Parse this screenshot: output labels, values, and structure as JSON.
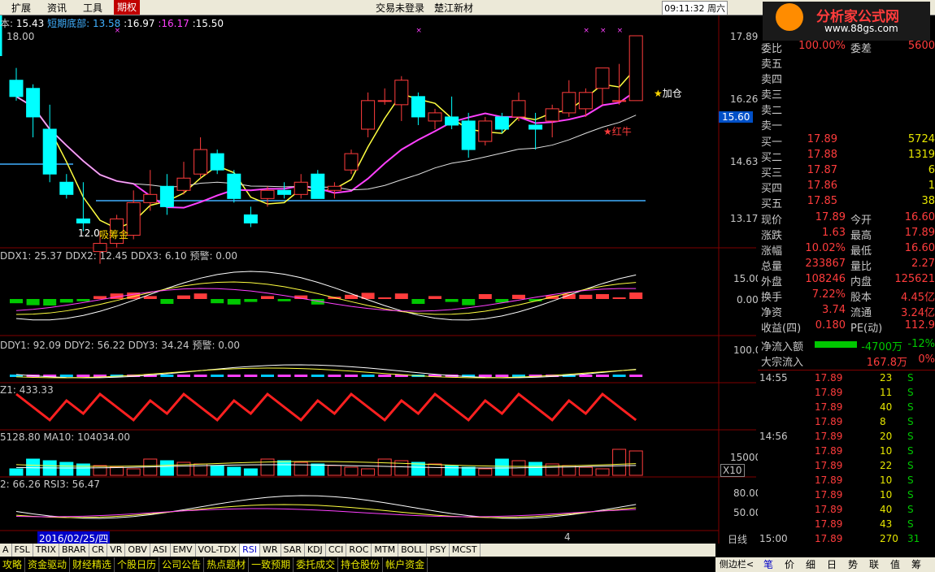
{
  "menu": {
    "items": [
      "扩展",
      "资讯",
      "工具"
    ],
    "active": "期权",
    "status": "交易未登录",
    "stock": "楚江新材",
    "clock": "09:11:32 周六"
  },
  "main": {
    "info": {
      "label": "本:",
      "p1": "15.43",
      "l2": "短期底部:",
      "p2": "13.58",
      "p3": "16.97",
      "p4": "16.17",
      "p5": "15.50"
    },
    "price_scale": [
      "17.89",
      "16.26",
      "14.63",
      "13.17"
    ],
    "left_price": "18.00",
    "current_price": "15.60",
    "annotation_add": "加仓",
    "annotation_red": "红牛",
    "low_label": "12.0",
    "buy_label": "吸筹金"
  },
  "ddx": {
    "info": "DDX1: 25.37  DDX2: 12.45  DDX3: 6.10  预警: 0.00",
    "scale": [
      "15.00",
      "0.00"
    ]
  },
  "ddy": {
    "info": "DDY1: 92.09  DDY2: 56.22  DDY3: 34.24  预警: 0.00",
    "scale": [
      "100.0"
    ]
  },
  "z": {
    "info": "Z1: 433.33"
  },
  "vol": {
    "info": "5128.80   MA10: 104034.00",
    "scale": [
      "15000"
    ],
    "unit": "X10"
  },
  "rsi": {
    "info": "2: 66.26  RSI3: 56.47",
    "scale": [
      "80.00",
      "50.00"
    ]
  },
  "date": "2016/02/25/四",
  "date_tick": "4",
  "period": "日线",
  "tabs": [
    "A",
    "FSL",
    "TRIX",
    "BRAR",
    "CR",
    "VR",
    "OBV",
    "ASI",
    "EMV",
    "VOL-TDX",
    "RSI",
    "WR",
    "SAR",
    "KDJ",
    "CCI",
    "ROC",
    "MTM",
    "BOLL",
    "PSY",
    "MCST"
  ],
  "tab_selected": "RSI",
  "bottom_tabs": [
    "攻略",
    "资金驱动",
    "财经精选",
    "个股日历",
    "公司公告",
    "热点题材",
    "一致预期",
    "委托成交",
    "持仓股份",
    "帐户资金"
  ],
  "side_button": "侧边栏<",
  "right_tabs": [
    "笔",
    "价",
    "细",
    "日",
    "势",
    "联",
    "值",
    "筹"
  ],
  "logo": {
    "title": "分析家公式网",
    "url": "www.88gs.com"
  },
  "quote": {
    "sell": [
      {
        "l": "卖五",
        "p": "",
        "q": ""
      },
      {
        "l": "卖四",
        "p": "",
        "q": ""
      },
      {
        "l": "卖三",
        "p": "",
        "q": ""
      },
      {
        "l": "卖二",
        "p": "",
        "q": ""
      },
      {
        "l": "卖一",
        "p": "",
        "q": ""
      }
    ],
    "buy": [
      {
        "l": "买一",
        "p": "17.89",
        "q": "5724"
      },
      {
        "l": "买二",
        "p": "17.88",
        "q": "1319"
      },
      {
        "l": "买三",
        "p": "17.87",
        "q": "6"
      },
      {
        "l": "买四",
        "p": "17.86",
        "q": "1"
      },
      {
        "l": "买五",
        "p": "17.85",
        "q": "38"
      }
    ],
    "stats": [
      {
        "a": "现价",
        "b": "17.89",
        "c": "今开",
        "d": "16.60"
      },
      {
        "a": "涨跌",
        "b": "1.63",
        "c": "最高",
        "d": "17.89"
      },
      {
        "a": "涨幅",
        "b": "10.02%",
        "c": "最低",
        "d": "16.60"
      },
      {
        "a": "总量",
        "b": "233867",
        "c": "量比",
        "d": "2.27"
      },
      {
        "a": "外盘",
        "b": "108246",
        "c": "内盘",
        "d": "125621"
      },
      {
        "a": "换手",
        "b": "7.22%",
        "c": "股本",
        "d": "4.45亿"
      },
      {
        "a": "净资",
        "b": "3.74",
        "c": "流通",
        "d": "3.24亿"
      },
      {
        "a": "收益(四)",
        "b": "0.180",
        "c": "PE(动)",
        "d": "112.9"
      }
    ],
    "netflow": {
      "l": "净流入额",
      "v": "-4700万",
      "p": "-12%"
    },
    "bigflow": {
      "l": "大宗流入",
      "v": "167.8万",
      "p": "0%"
    },
    "weibi": {
      "l": "委比",
      "v": "100.00%",
      "l2": "委差",
      "v2": "5600"
    }
  },
  "ticks": [
    {
      "t": "14:55",
      "p": "17.89",
      "q": "23",
      "s": "S"
    },
    {
      "t": "",
      "p": "17.89",
      "q": "11",
      "s": "S"
    },
    {
      "t": "",
      "p": "17.89",
      "q": "40",
      "s": "S"
    },
    {
      "t": "",
      "p": "17.89",
      "q": "8",
      "s": "S"
    },
    {
      "t": "14:56",
      "p": "17.89",
      "q": "20",
      "s": "S"
    },
    {
      "t": "",
      "p": "17.89",
      "q": "10",
      "s": "S"
    },
    {
      "t": "",
      "p": "17.89",
      "q": "22",
      "s": "S"
    },
    {
      "t": "",
      "p": "17.89",
      "q": "10",
      "s": "S"
    },
    {
      "t": "",
      "p": "17.89",
      "q": "10",
      "s": "S"
    },
    {
      "t": "",
      "p": "17.89",
      "q": "40",
      "s": "S"
    },
    {
      "t": "",
      "p": "17.89",
      "q": "43",
      "s": "S"
    },
    {
      "t": "15:00",
      "p": "17.89",
      "q": "270",
      "s": "31"
    }
  ]
}
